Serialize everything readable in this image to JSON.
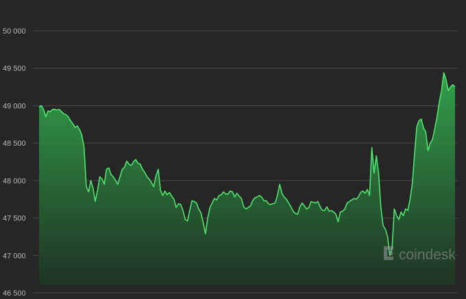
{
  "chart_data": {
    "type": "area",
    "ylim": [
      46500,
      50000
    ],
    "y_ticks": [
      {
        "value": 50000,
        "label": "50 000"
      },
      {
        "value": 49500,
        "label": "49 500"
      },
      {
        "value": 49000,
        "label": "49 000"
      },
      {
        "value": 48500,
        "label": "48 500"
      },
      {
        "value": 48000,
        "label": "48 000"
      },
      {
        "value": 47500,
        "label": "47 500"
      },
      {
        "value": 47000,
        "label": "47 000"
      },
      {
        "value": 46500,
        "label": "46 500"
      }
    ],
    "grid": true,
    "series": [
      {
        "values": [
          48980,
          49000,
          48950,
          48850,
          48930,
          48920,
          48950,
          48950,
          48940,
          48950,
          48920,
          48890,
          48880,
          48850,
          48800,
          48760,
          48710,
          48730,
          48680,
          48610,
          48450,
          47920,
          47850,
          48000,
          47900,
          47720,
          47870,
          48050,
          48020,
          47950,
          48150,
          48170,
          48080,
          48050,
          48000,
          47950,
          48050,
          48150,
          48180,
          48260,
          48220,
          48200,
          48250,
          48280,
          48230,
          48220,
          48150,
          48110,
          48050,
          48020,
          47970,
          47920,
          48060,
          48150,
          47870,
          47800,
          47860,
          47810,
          47840,
          47790,
          47750,
          47640,
          47690,
          47680,
          47600,
          47480,
          47460,
          47600,
          47730,
          47720,
          47700,
          47620,
          47570,
          47440,
          47290,
          47500,
          47640,
          47700,
          47760,
          47740,
          47800,
          47810,
          47850,
          47820,
          47820,
          47860,
          47850,
          47780,
          47830,
          47790,
          47760,
          47650,
          47620,
          47640,
          47660,
          47730,
          47770,
          47780,
          47800,
          47780,
          47730,
          47730,
          47690,
          47680,
          47690,
          47700,
          47800,
          47950,
          47830,
          47780,
          47750,
          47700,
          47650,
          47590,
          47560,
          47550,
          47650,
          47700,
          47660,
          47620,
          47640,
          47720,
          47710,
          47700,
          47720,
          47650,
          47600,
          47600,
          47650,
          47590,
          47600,
          47580,
          47550,
          47450,
          47580,
          47590,
          47620,
          47700,
          47720,
          47740,
          47760,
          47750,
          47780,
          47840,
          47860,
          47830,
          47880,
          47800,
          48440,
          48100,
          48330,
          48100,
          47650,
          47400,
          47350,
          47250,
          47000,
          47100,
          47620,
          47530,
          47480,
          47580,
          47530,
          47620,
          47600,
          47750,
          47960,
          48350,
          48720,
          48800,
          48820,
          48700,
          48650,
          48400,
          48500,
          48550,
          48700,
          48850,
          49050,
          49200,
          49440,
          49350,
          49200,
          49250,
          49280,
          49250
        ]
      }
    ],
    "watermark": {
      "text": "coindesk",
      "icon": "coindesk-logo-icon"
    },
    "colors": {
      "background": "#262626",
      "line": "#4ee66c",
      "fill_top": "#33a64c",
      "fill_bottom": "#1f3524",
      "grid": "#4a4a4a",
      "tick_text": "#b9b9b9"
    }
  }
}
